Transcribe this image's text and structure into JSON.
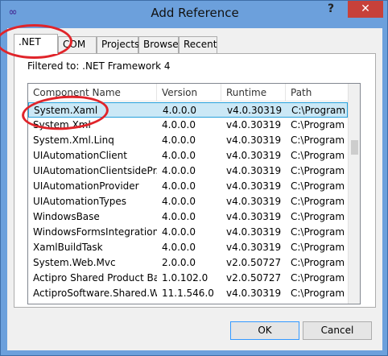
{
  "window": {
    "title": "Add Reference",
    "icon": "visual-studio-infinity-icon",
    "help_label": "?",
    "close_label": "✕"
  },
  "tabs": [
    {
      "label": ".NET",
      "active": true
    },
    {
      "label": "COM"
    },
    {
      "label": "Projects"
    },
    {
      "label": "Browse"
    },
    {
      "label": "Recent"
    }
  ],
  "filter_label": "Filtered to: .NET Framework 4",
  "list": {
    "columns": [
      "Component Name",
      "Version",
      "Runtime",
      "Path"
    ],
    "rows": [
      {
        "name": "System.Xaml",
        "version": "4.0.0.0",
        "runtime": "v4.0.30319",
        "path": "C:\\Program",
        "selected": true
      },
      {
        "name": "System.Xml",
        "version": "4.0.0.0",
        "runtime": "v4.0.30319",
        "path": "C:\\Program"
      },
      {
        "name": "System.Xml.Linq",
        "version": "4.0.0.0",
        "runtime": "v4.0.30319",
        "path": "C:\\Program"
      },
      {
        "name": "UIAutomationClient",
        "version": "4.0.0.0",
        "runtime": "v4.0.30319",
        "path": "C:\\Program"
      },
      {
        "name": "UIAutomationClientsidePr...",
        "version": "4.0.0.0",
        "runtime": "v4.0.30319",
        "path": "C:\\Program"
      },
      {
        "name": "UIAutomationProvider",
        "version": "4.0.0.0",
        "runtime": "v4.0.30319",
        "path": "C:\\Program"
      },
      {
        "name": "UIAutomationTypes",
        "version": "4.0.0.0",
        "runtime": "v4.0.30319",
        "path": "C:\\Program"
      },
      {
        "name": "WindowsBase",
        "version": "4.0.0.0",
        "runtime": "v4.0.30319",
        "path": "C:\\Program"
      },
      {
        "name": "WindowsFormsIntegration",
        "version": "4.0.0.0",
        "runtime": "v4.0.30319",
        "path": "C:\\Program"
      },
      {
        "name": "XamlBuildTask",
        "version": "4.0.0.0",
        "runtime": "v4.0.30319",
        "path": "C:\\Program"
      },
      {
        "name": "System.Web.Mvc",
        "version": "2.0.0.0",
        "runtime": "v2.0.50727",
        "path": "C:\\Program"
      },
      {
        "name": "Actipro Shared Product Ba...",
        "version": "1.0.102.0",
        "runtime": "v2.0.50727",
        "path": "C:\\Program"
      },
      {
        "name": "ActiproSoftware.Shared.W...",
        "version": "11.1.546.0",
        "runtime": "v4.0.30319",
        "path": "C:\\Program"
      }
    ]
  },
  "buttons": {
    "ok": "OK",
    "cancel": "Cancel"
  },
  "colors": {
    "annotation": "#e0242a",
    "selection": "#cbe8f6",
    "title_bar": "#6ca0dc",
    "close_button": "#c7413a"
  }
}
